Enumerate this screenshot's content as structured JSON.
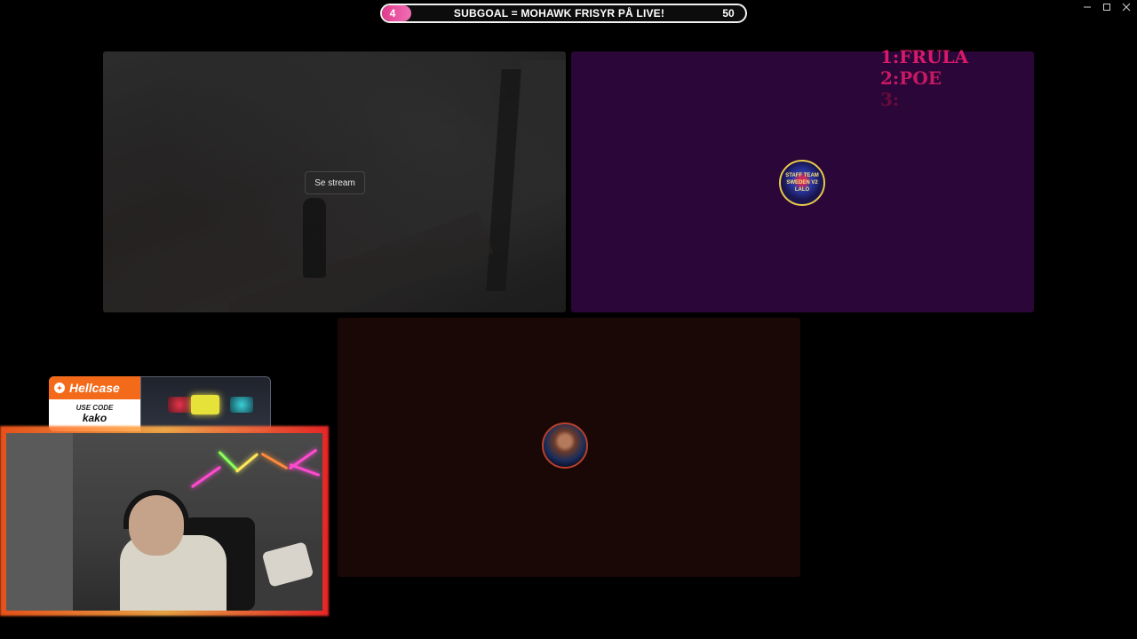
{
  "window": {
    "controls": {
      "minimize_icon": "minimize-icon",
      "maximize_icon": "maximize-icon",
      "close_icon": "close-icon"
    }
  },
  "subgoal": {
    "current": "4",
    "title": "SUBGOAL = MOHAWK FRISYR PÅ LIVE!",
    "target": "50",
    "progress_fraction": 0.08,
    "fill_color": "#e23a8e"
  },
  "streams": [
    {
      "id": "game",
      "overlay_button": "Se stream"
    },
    {
      "id": "team",
      "avatar_icon": "team-logo-icon",
      "avatar_text": "STAFF TEAM SWEDEN V2 LALO",
      "background": "#2b0638"
    },
    {
      "id": "face",
      "avatar_icon": "portrait-avatar-icon",
      "background": "#1a0807"
    }
  ],
  "ranking": [
    "1:FRULA",
    "2:POE",
    "3:"
  ],
  "sponsor": {
    "brand": "Hellcase",
    "code_label": "USE CODE",
    "code": "kako",
    "accent": "#f36a1a"
  }
}
